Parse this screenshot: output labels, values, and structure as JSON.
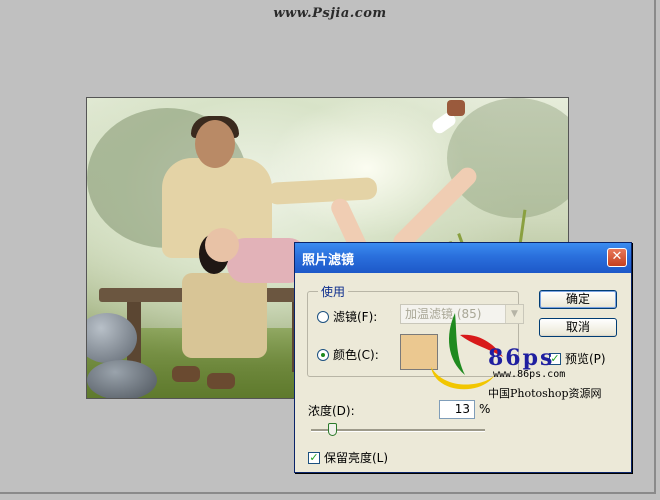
{
  "watermark": {
    "site": "www.Psjia.com"
  },
  "photo": {
    "description_icon": "photo-couple-icon"
  },
  "dialog": {
    "title": "照片滤镜",
    "close_glyph": "✕",
    "group_label": "使用",
    "filter_label": "滤镜(F):",
    "filter_value": "加温滤镜 (85)",
    "color_label": "颜色(C):",
    "color_hex": "#ebc890",
    "filter_selected": false,
    "color_selected": true,
    "ok_label": "确定",
    "cancel_label": "取消",
    "preview_label": "预览(P)",
    "preview_checked": true,
    "density_label": "浓度(D):",
    "density_value": "13",
    "density_unit": "%",
    "density_percent": 13,
    "preserve_label": "保留亮度(L)",
    "preserve_checked": true
  },
  "logo": {
    "brand": "86ps",
    "url": "www.86ps.com",
    "caption": "中国Photoshop资源网"
  }
}
